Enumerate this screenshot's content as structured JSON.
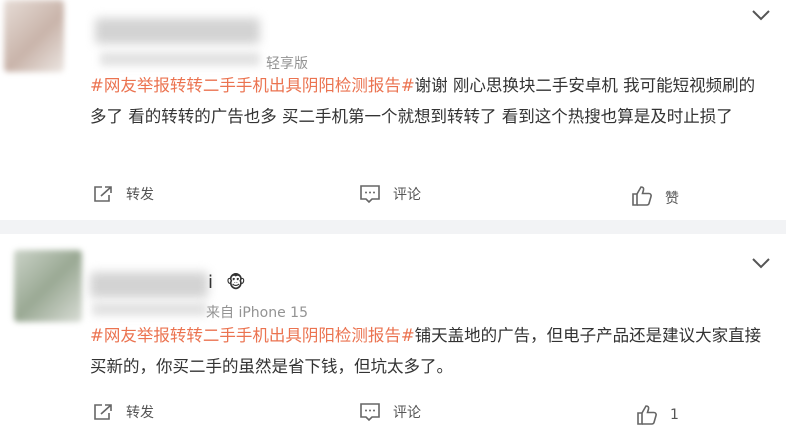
{
  "posts": [
    {
      "name_tail": "",
      "source": "轻享版",
      "topic": "#网友举报转转二手手机出具阴阳检测报告#",
      "text": "谢谢 刚心思换块二手安卓机 我可能短视频刷的多了 看的转转的广告也多 买二手机第一个就想到转转了 看到这个热搜也算是及时止损了",
      "actions": {
        "repost": "转发",
        "comment": "评论",
        "like": "赞"
      }
    },
    {
      "name_tail": "i",
      "badge": "🐵",
      "source": "来自 iPhone 15",
      "topic": "#网友举报转转二手手机出具阴阳检测报告#",
      "text": "铺天盖地的广告，但电子产品还是建议大家直接买新的，你买二手的虽然是省下钱，但坑太多了。",
      "actions": {
        "repost": "转发",
        "comment": "评论",
        "like": "1"
      }
    }
  ],
  "colors": {
    "topic": "#eb7350",
    "separator": "#f2f3f5"
  }
}
